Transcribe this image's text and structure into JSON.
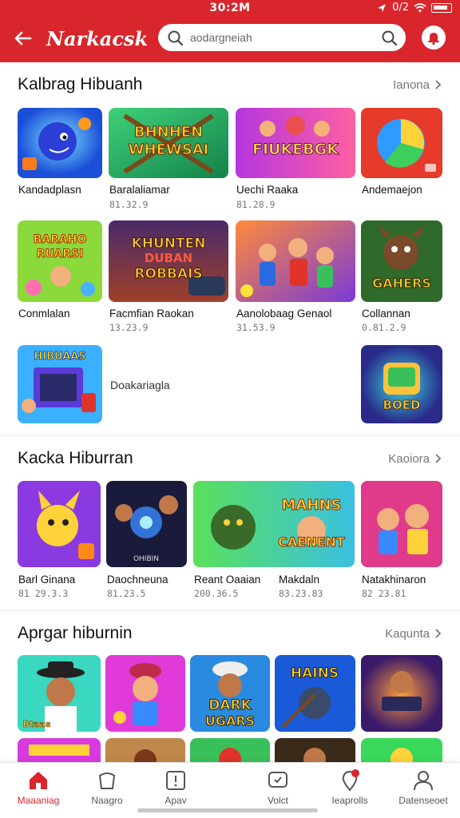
{
  "status_bar": {
    "time": "30:2M",
    "signal_text": "0/2"
  },
  "header": {
    "app_title": "Narkacsk",
    "search_placeholder": "aodargneiah"
  },
  "sections": [
    {
      "title": "Kalbrag Hibuanh",
      "more": "Ianona",
      "items": [
        {
          "label": "Kandadplasn",
          "sub": ""
        },
        {
          "label": "Baralaliamar",
          "sub": "81.32.9"
        },
        {
          "label": "Uechi Raaka",
          "sub": "81.28.9"
        },
        {
          "label": "Andemaejon",
          "sub": ""
        },
        {
          "label": "Conmlalan",
          "sub": ""
        },
        {
          "label": "Facmfian Raokan",
          "sub": "13.23.9"
        },
        {
          "label": "Aanolobaag Genaol",
          "sub": "31.53.9"
        },
        {
          "label": "Collannan",
          "sub": "0.81.2.9"
        },
        {
          "label": "",
          "sub": ""
        },
        {
          "label": "Doakariagla",
          "sub": ""
        },
        {
          "label": "",
          "sub": ""
        }
      ]
    },
    {
      "title": "Kacka Hiburran",
      "more": "Kaoiora",
      "items": [
        {
          "label": "Barl Ginana",
          "sub": "81 29.3.3"
        },
        {
          "label": "Daochneuna",
          "sub": "81.23.5"
        },
        {
          "label": "Reant Oaaian",
          "sub": "200.36.5"
        },
        {
          "label": "Makdaln",
          "sub": "83.23.83"
        },
        {
          "label": "Natakhinaron",
          "sub": "82 23.81"
        }
      ]
    },
    {
      "title": "Aprgar hiburnin",
      "more": "Kaqunta",
      "items": [
        {
          "label": "",
          "sub": ""
        },
        {
          "label": "",
          "sub": ""
        },
        {
          "label": "",
          "sub": ""
        },
        {
          "label": "",
          "sub": ""
        },
        {
          "label": "",
          "sub": ""
        }
      ]
    }
  ],
  "tile_art_text": {
    "t2": "BHNHEN WHEWSAI",
    "t3": "FIUKEBGK",
    "t5": "BARAHO RUARSI",
    "t6": "KHUNTEN DUBAN ROBBAIS",
    "t8": "GAHERS",
    "t9": "HIBUAAS",
    "t11": "BOED",
    "s2t2": "OHIBIN",
    "s2t3": "MAHNS",
    "s2t4": "CAENENT",
    "s3t1": "Btaas",
    "s3t3": "DARK UGARS",
    "s3t4": "HAINS"
  },
  "bottom_nav": [
    {
      "label": "Maaaniag",
      "icon": "home-icon",
      "active": true
    },
    {
      "label": "Naagro",
      "icon": "shop-icon",
      "active": false
    },
    {
      "label": "Apav",
      "icon": "apps-icon",
      "active": false
    },
    {
      "label": "Volct",
      "icon": "chat-icon",
      "active": false
    },
    {
      "label": "Ieaprolls",
      "icon": "map-pin-icon",
      "active": false,
      "badge": true
    },
    {
      "label": "Datenseoet",
      "icon": "user-icon",
      "active": false
    }
  ],
  "colors": {
    "brand_red": "#d8262c",
    "text": "#111111",
    "muted": "#777777"
  }
}
